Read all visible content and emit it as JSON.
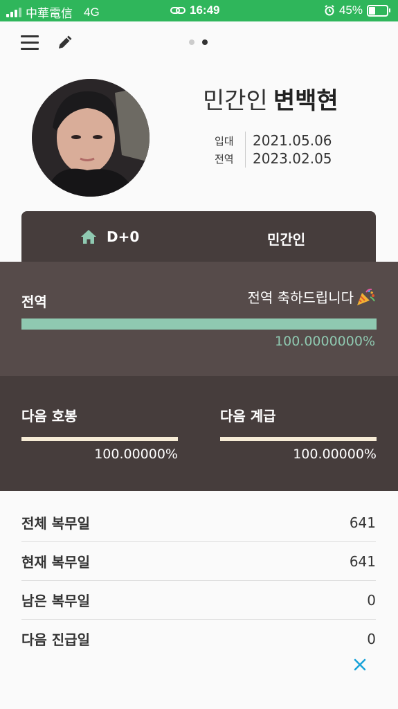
{
  "status_bar": {
    "carrier": "中華電信",
    "network": "4G",
    "time": "16:49",
    "battery": "45%",
    "battery_level": 0.45
  },
  "pager": {
    "pages": 2,
    "active_index": 1
  },
  "profile": {
    "prefix": "민간인",
    "name": "변백현",
    "enlist_label": "입대",
    "enlist_date": "2021.05.06",
    "discharge_label": "전역",
    "discharge_date": "2023.02.05"
  },
  "tabs": {
    "dday": "D+0",
    "status": "민간인"
  },
  "discharge_progress": {
    "title": "전역",
    "message": "전역 축하드립니다",
    "percent_text": "100.0000000%",
    "fraction": 1.0
  },
  "next_pay_grade": {
    "title": "다음 호봉",
    "percent_text": "100.00000%",
    "fraction": 1.0
  },
  "next_rank": {
    "title": "다음 계급",
    "percent_text": "100.00000%",
    "fraction": 1.0
  },
  "stats": [
    {
      "label": "전체 복무일",
      "value": "641"
    },
    {
      "label": "현재 복무일",
      "value": "641"
    },
    {
      "label": "남은 복무일",
      "value": "0"
    },
    {
      "label": "다음 진급일",
      "value": "0"
    }
  ],
  "colors": {
    "status_bar": "#2fb65b",
    "dark_brown": "#463d3c",
    "mid_brown": "#564b4a",
    "progress_mint": "#8fc9b1",
    "progress_cream": "#f7ecd6"
  },
  "icons": {
    "menu": "menu-icon",
    "edit": "pencil-icon",
    "home": "home-icon",
    "party": "party-popper-icon",
    "close": "close-icon"
  }
}
